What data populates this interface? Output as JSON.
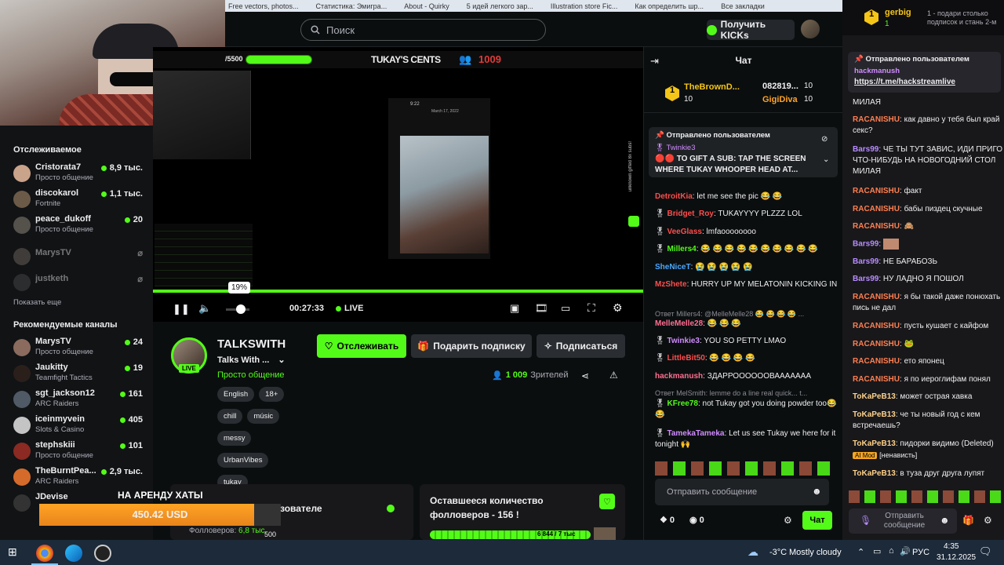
{
  "browser": {
    "bookmarks": [
      "Free vectors, photos...",
      "Статистика: Эмигра...",
      "About - Quirky",
      "5 идей легкого зар...",
      "Illustration store Fic...",
      "Как определить шр...",
      "Все закладки"
    ]
  },
  "topbar": {
    "search_placeholder": "Поиск",
    "kicks_button": "Получить KICKs"
  },
  "sidebar": {
    "following_title": "Отслеживаемое",
    "following": [
      {
        "name": "Cristorata7",
        "category": "Просто общение",
        "viewers": "8,9 тыс.",
        "online": true,
        "color": "#c9a38a"
      },
      {
        "name": "discokarol",
        "category": "Fortnite",
        "viewers": "1,1 тыс.",
        "online": true,
        "color": "#6c5a48"
      },
      {
        "name": "peace_dukoff",
        "category": "Просто общение",
        "viewers": "20",
        "online": true,
        "color": "#55514b"
      },
      {
        "name": "MarysTV",
        "category": "",
        "viewers": "",
        "online": false,
        "color": "#7a6f66"
      },
      {
        "name": "justketh",
        "category": "",
        "viewers": "",
        "online": false,
        "color": "#4d4d4d"
      }
    ],
    "show_more": "Показать еще",
    "recommended_title": "Рекомендуемые каналы",
    "recommended": [
      {
        "name": "MarysTV",
        "category": "Просто общение",
        "viewers": "24",
        "color": "#8a6b5e"
      },
      {
        "name": "Jaukitty",
        "category": "Teamfight Tactics",
        "viewers": "19",
        "color": "#2b1f1c"
      },
      {
        "name": "sgt_jackson12",
        "category": "ARC Raiders",
        "viewers": "161",
        "color": "#505a66"
      },
      {
        "name": "iceinmyvein",
        "category": "Slots & Casino",
        "viewers": "405",
        "color": "#c4c4c4"
      },
      {
        "name": "stephskiii",
        "category": "Просто общение",
        "viewers": "101",
        "color": "#8a2a22"
      },
      {
        "name": "TheBurntPea...",
        "category": "ARC Raiders",
        "viewers": "2,9 тыс.",
        "color": "#d46b2b"
      },
      {
        "name": "JDevise",
        "category": "",
        "viewers": "",
        "color": "#333"
      }
    ]
  },
  "overlay": {
    "goal_text": "/5500",
    "brand": "TUKAY'S CENTS",
    "counter": "1009",
    "rent_title": "НА АРЕНДУ ХАТЫ",
    "rent_amount": "450.42 USD",
    "rent_progress": 0.89
  },
  "player": {
    "time": "00:27:33",
    "live_label": "LIVE",
    "volume_tooltip": "19%",
    "volume": 0.19,
    "phone_time": "9:22",
    "phone_date": "March 17, 2022",
    "side_text": "unknown gifted 8x subs!"
  },
  "stream": {
    "channel_name": "TALKSWITH",
    "title": "Talks With ...",
    "category": "Просто общение",
    "follow_button": "Отслеживать",
    "gift_button": "Подарить подписку",
    "subscribe_button": "Подписаться",
    "viewers": "1 009",
    "viewers_label": "Зрителей",
    "tags": [
      "English",
      "18+",
      "chill",
      "músic",
      "messy",
      "UrbanVibes",
      "tukay"
    ],
    "live_badge": "LIVE"
  },
  "panels": {
    "left_title": "ользователе",
    "left_label": "Фолловеров:",
    "left_value": "6,8 тыс.",
    "left_extra": "500",
    "right_title": "Оставшееся количество фолловеров - 156 !",
    "right_progress": "6 844 / 7 тыс"
  },
  "chat": {
    "title": "Чат",
    "leader1_name": "TheBrownD...",
    "leader1_count": "10",
    "leader2_name": "082819...",
    "leader2_count": "10",
    "leader3_name": "GigiDiva",
    "leader3_count": "10",
    "pinned_header": "Отправлено пользователем",
    "pinned_user": "Twinkie3",
    "pinned_text": "TO GIFT A SUB: TAP THE SCREEN WHERE TUKAY WHOOPER HEAD AT...",
    "messages": [
      {
        "user": "DetroitKia",
        "color": "#ff4d4d",
        "text": "let me see the pic 😂 😂"
      },
      {
        "user": "Bridget_Roy",
        "color": "#ff4d4d",
        "text": "TUKAYYYY PLZZZ LOL"
      },
      {
        "user": "VeeGlass",
        "color": "#ff4d4d",
        "text": "lmfaoooooooo"
      },
      {
        "user": "Millers4",
        "color": "#53fc18",
        "text": "😂 😂 😂 😂 😂 😂 😂 😂 😂 😂"
      },
      {
        "user": "SheNiceT",
        "color": "#4aa8ff",
        "text": "😭 😭 😭 😭 😭"
      },
      {
        "user": "MzShete",
        "color": "#ff4d4d",
        "text": "HURRY UP MY MELATONIN KICKING IN"
      },
      {
        "user": "MelleMelle28",
        "color": "#ff6f91",
        "text": "😂 😂 😂"
      },
      {
        "user": "Twinkie3",
        "color": "#d08cff",
        "text": "YOU SO PETTY LMAO"
      },
      {
        "user": "LittleBit50",
        "color": "#ff4d4d",
        "text": "😂 😂 😂 😂"
      },
      {
        "user": "hackmanush",
        "color": "#ff6f91",
        "text": "ЗДАРРООООООВААААААА"
      },
      {
        "user": "KFree78",
        "color": "#53fc18",
        "text": "not Tukay got you doing powder too😂 😂"
      },
      {
        "user": "TamekaTameka",
        "color": "#d08cff",
        "text": "Let us see Tukay we here for it tonight 🙌"
      }
    ],
    "reply1": "Ответ Millers4: @MelleMelle28 😂 😂 😂 😂 ...",
    "reply2": "Ответ MelSmith: lemme do a line real quick... t...",
    "input_placeholder": "Отправить сообщение",
    "send_button": "Чат",
    "counter1": "0",
    "counter2": "0"
  },
  "rpanel": {
    "user": "gerbig",
    "user_count": "1",
    "top_text": "1 - подари столько подписок и стань 2-м",
    "pinned_header": "Отправлено пользователем",
    "pinned_user": "hackmanush",
    "pinned_link": "https://t.me/hackstreamlive",
    "messages": [
      {
        "user": "",
        "text": "МИЛАЯ"
      },
      {
        "user": "RACANISHU",
        "text": "как давно у тебя был край секс?"
      },
      {
        "user": "Bars99",
        "text": "ЧЕ ТЫ ТУТ ЗАВИС, ИДИ ПРИГО ЧТО-НИБУДЬ НА НОВОГОДНИЙ СТОЛ МИЛАЯ"
      },
      {
        "user": "RACANISHU",
        "text": "факт"
      },
      {
        "user": "RACANISHU",
        "text": "бабы пиздец скучные"
      },
      {
        "user": "RACANISHU",
        "text": "🙈"
      },
      {
        "user": "Bars99",
        "text": ""
      },
      {
        "user": "Bars99",
        "text": "НЕ БАРАБОЗЬ"
      },
      {
        "user": "Bars99",
        "text": "НУ ЛАДНО Я ПОШОЛ"
      },
      {
        "user": "RACANISHU",
        "text": "я бы такой даже понюхать пись не дал"
      },
      {
        "user": "RACANISHU",
        "text": "пусть кушает с кайфом"
      },
      {
        "user": "RACANISHU",
        "text": "🐸"
      },
      {
        "user": "RACANISHU",
        "text": "ето японец"
      },
      {
        "user": "RACANISHU",
        "text": "я по иероглифам понял"
      },
      {
        "user": "ToKaPeB13",
        "text": "может острая хавка"
      },
      {
        "user": "ToKaPeB13",
        "text": "че ты новый год с кем встречаешь?"
      },
      {
        "user": "ToKaPeB13",
        "text": "пидорки видимо (Deleted)"
      },
      {
        "user": "ToKaPeB13",
        "text": "в туза друг друга лупят"
      }
    ],
    "mod_badge": "AI Mod",
    "hate_tag": "[ненависть]",
    "input_placeholder": "Отправить сообщение"
  },
  "taskbar": {
    "weather_temp": "-3°C",
    "weather_text": "Mostly cloudy",
    "lang": "РУС",
    "time": "4:35",
    "date": "31.12.2025"
  }
}
